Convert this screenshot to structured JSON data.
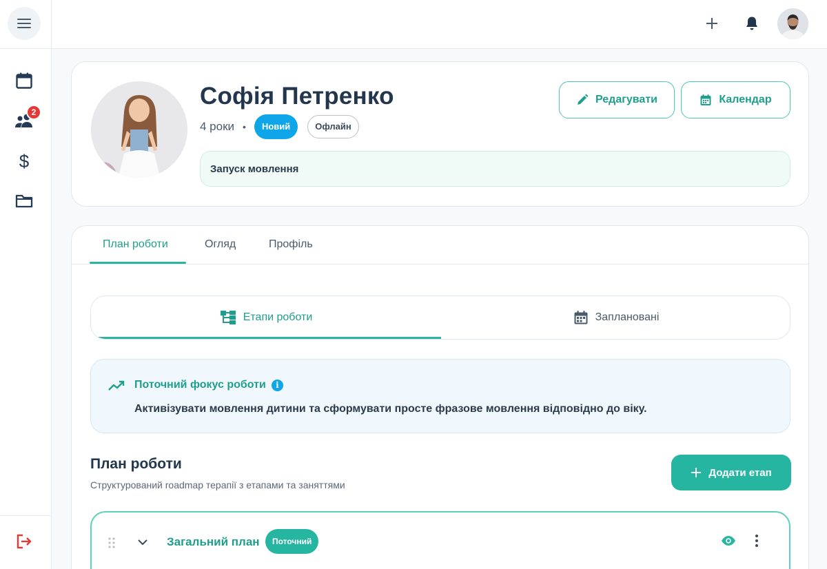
{
  "header": {
    "notifications_badge": "2"
  },
  "profile": {
    "name": "Софія Петренко",
    "age": "4 роки",
    "separator": "•",
    "tag_new": "Новий",
    "tag_mode": "Офлайн",
    "goal": "Запуск мовлення",
    "edit_label": "Редагувати",
    "calendar_label": "Календар"
  },
  "tabs": [
    {
      "label": "План роботи",
      "active": true
    },
    {
      "label": "Огляд",
      "active": false
    },
    {
      "label": "Профіль",
      "active": false
    }
  ],
  "segments": [
    {
      "label": "Етапи роботи",
      "icon": "sitemap-icon",
      "active": true
    },
    {
      "label": "Заплановані",
      "icon": "calendar-icon",
      "active": false
    }
  ],
  "focus": {
    "title": "Поточний фокус роботи",
    "info_glyph": "i",
    "text": "Активізувати мовлення дитини та сформувати просте фразове мовлення відповідно до віку."
  },
  "plan": {
    "title": "План роботи",
    "subtitle": "Структурований roadmap терапії з етапами та заняттями",
    "add_label": "Додати етап"
  },
  "stage": {
    "name": "Загальний план",
    "status": "Поточний"
  },
  "colors": {
    "accent": "#26b5a0",
    "accent_text": "#1e9e8c",
    "blue": "#0ea5e9",
    "badge_red": "#e53935",
    "navy": "#22364e"
  }
}
